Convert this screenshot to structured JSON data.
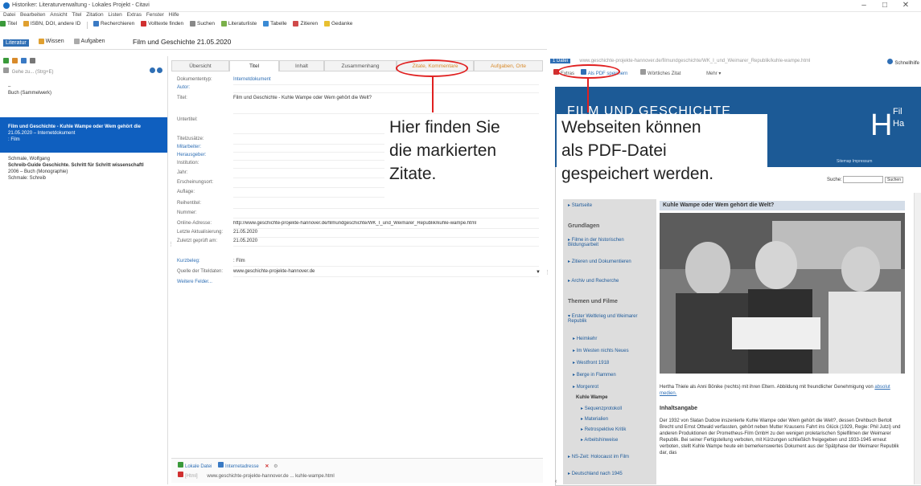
{
  "window": {
    "title": "Historiker: Literaturverwaltung - Lokales Projekt - Citavi",
    "controls": [
      "–",
      "□",
      "✕"
    ]
  },
  "menu": [
    "Datei",
    "Bearbeiten",
    "Ansicht",
    "Titel",
    "Zitation",
    "Listen",
    "Extras",
    "Fenster",
    "Hilfe"
  ],
  "toolbar": {
    "items": [
      "Titel",
      "ISBN, DOI, andere ID",
      "Recherchieren",
      "Volltexte finden",
      "Suchen",
      "Literaturliste",
      "Tabelle",
      "Zitieren",
      "Gedanke"
    ]
  },
  "nav": {
    "tabs": [
      "Literatur",
      "Wissen",
      "Aufgaben"
    ],
    "title": "Film und Geschichte 21.05.2020"
  },
  "left": {
    "search_placeholder": "Gehe zu... (Strg+E)",
    "refs": [
      {
        "line1": "–",
        "line2": "Buch (Sammelwerk)",
        "line3": "",
        "selected": false
      },
      {
        "line1": "Film und Geschichte - Kuhle Wampe oder Wem gehört die",
        "line2": "21.05.2020 – Internetdokument",
        "line3": ": Film",
        "selected": true
      },
      {
        "line1": "Schmale, Wolfgang",
        "line2": "Schreib-Guide Geschichte. Schritt für Schritt wissenschaftl",
        "line3": "2006 – Buch (Monographie)",
        "line4": "Schmale: Schreib",
        "selected": false
      }
    ]
  },
  "middle": {
    "tabs": [
      "Übersicht",
      "Titel",
      "Inhalt",
      "Zusammenhang",
      "Zitate, Kommentare",
      "Aufgaben, Orte"
    ],
    "fields": [
      {
        "label": "Dokumententyp:",
        "value": "Internetdokument",
        "link": false
      },
      {
        "label": "Autor:",
        "value": "",
        "link": true
      },
      {
        "label": "Titel:",
        "value": "Film und Geschichte - Kuhle Wampe oder Wem gehört die Welt?",
        "link": false
      },
      {
        "label": "Untertitel:",
        "value": "",
        "link": false
      },
      {
        "label": "Titelzusätze:",
        "value": "",
        "link": false
      },
      {
        "label": "Mitarbeiter:",
        "value": "",
        "link": true
      },
      {
        "label": "Herausgeber:",
        "value": "",
        "link": true
      },
      {
        "label": "Institution:",
        "value": "",
        "link": false
      },
      {
        "label": "Jahr:",
        "value": "",
        "link": false
      },
      {
        "label": "Erscheinungsort:",
        "value": "",
        "link": false
      },
      {
        "label": "Auflage:",
        "value": "",
        "link": false
      },
      {
        "label": "Reihentitel:",
        "value": "",
        "link": false
      },
      {
        "label": "Nummer:",
        "value": "",
        "link": false
      },
      {
        "label": "Online-Adresse:",
        "value": "http://www.geschichte-projekte-hannover.de/filmundgeschichte/WK_I_und_Weimarer_Republik/kuhle-wampe.html",
        "link": false
      },
      {
        "label": "Letzte Aktualisierung:",
        "value": "21.05.2020",
        "link": false
      },
      {
        "label": "Zuletzt geprüft am:",
        "value": "21.05.2020",
        "link": false
      },
      {
        "label": "Kurzbeleg:",
        "value": ": Film",
        "link": true
      },
      {
        "label": "Quelle der Titeldaten:",
        "value": "www.geschichte-projekte-hannover.de",
        "link": false
      },
      {
        "label": "Weitere Felder...",
        "value": "",
        "link": true
      }
    ],
    "bottom": {
      "local_files": "Lokale Datei",
      "internet": "Internetadresse",
      "html_label": "[Html]",
      "url": "www.geschichte-projekte-hannover.de ... kuhle-wampe.html"
    }
  },
  "right": {
    "topbar": {
      "dropdown": "1 Datei",
      "url": "www.geschichte-projekte-hannover.de/filmundgeschichte/WK_I_und_Weimarer_Republik/kuhle-wampe.html",
      "quick": "Schnellhilfe"
    },
    "toolbar": [
      "Extras",
      "Als PDF speichern",
      "Wörtliches Zitat",
      "Mehr"
    ],
    "web": {
      "logo": "FILM UND GESCHICHTE",
      "header_right": "Fil Ha",
      "sitemap": "Sitemap",
      "impressum": "Impressum",
      "search_label": "Suche:",
      "search_btn": "Suchen",
      "side_start": "Startseite",
      "side_grund": "Grundlagen",
      "side_items": [
        "Filme in der historischen Bildungsarbeit",
        "Zitieren und Dokumentieren",
        "Archiv und Recherche"
      ],
      "side_themen": "Themen und Filme",
      "side_sub": [
        "Erster Weltkrieg und Weimarer Republik",
        "Heimkehr",
        "Im Westen nichts Neues",
        "Westfront 1918",
        "Berge in Flammen",
        "Morgenrot",
        "Kuhle Wampe",
        "Sequenzprotokoll",
        "Materialien",
        "Retrospektive Kritik",
        "Arbeitshinweise",
        "NS-Zeit: Holocaust im Film",
        "Deutschland nach 1945"
      ],
      "article_title": "Kuhle Wampe oder Wem gehört die Welt?",
      "caption": "Hertha Thiele als Anni Bönike (rechts) mit ihren Eltern. Abbildung mit freundlicher Genehmigung von",
      "caption_link": "absolut medien.",
      "inhalt_head": "Inhaltsangabe",
      "inhalt": "Der 1932 von Slatan Dudow inszenierte Kuhle Wampe oder Wem gehört die Welt?, dessen Drehbuch Bertolt Brecht und Ernst Ottwald verfassten, gehört neben Mutter Krausens Fahrt ins Glück (1929, Regie: Phil Jutzi) und anderen Produktionen der Prometheus-Film GmbH zu den wenigen proletarischen Spielfilmen der Weimarer Republik. Bei seiner Fertigstellung verboten, mit Kürzungen schließlich freigegeben und 1933-1945 erneut verboten, stellt Kuhle Wampe heute ein bemerkenswertes Dokument aus der Spätphase der Weimarer Republik dar, das"
    }
  },
  "annotations": {
    "callout_left": [
      "Hier finden Sie",
      "die markierten",
      "Zitate."
    ],
    "callout_right": [
      "Webseiten können",
      "als PDF-Datei",
      "gespeichert werden."
    ]
  },
  "colors": {
    "accent": "#2f6fb5",
    "selection": "#0f5fbf",
    "annotation": "#e02020",
    "web_header": "#1c5a96",
    "tab_highlight": "#d88a2b"
  }
}
